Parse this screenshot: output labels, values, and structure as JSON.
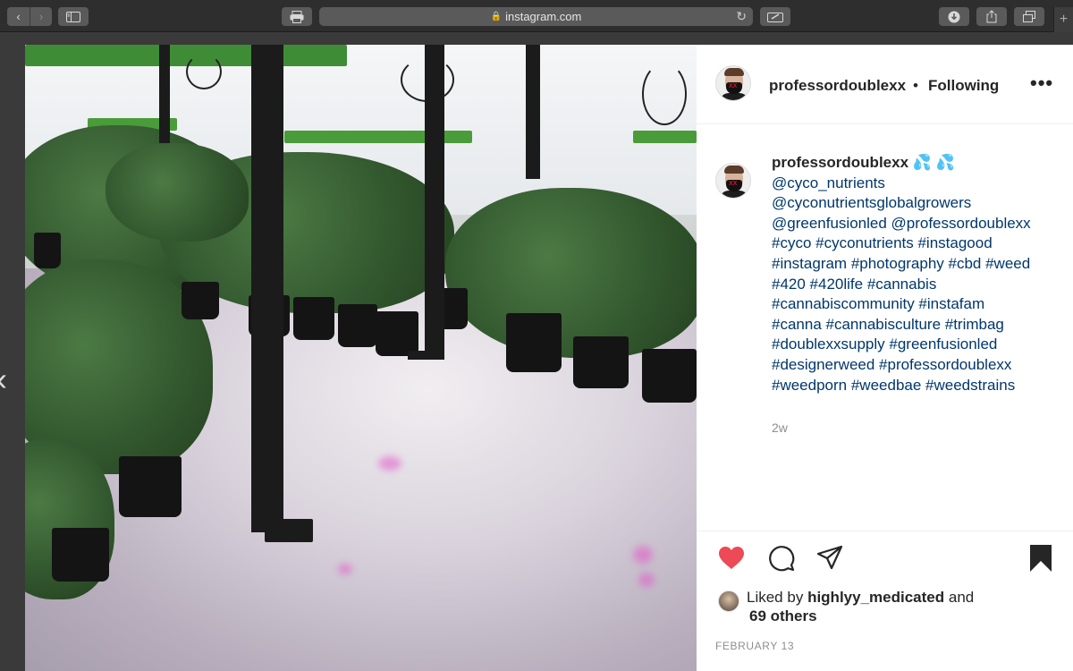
{
  "browser": {
    "url": "instagram.com"
  },
  "post": {
    "header": {
      "username": "professordoublexx",
      "separator": "•",
      "follow_status": "Following",
      "more": "•••"
    },
    "caption": {
      "username": "professordoublexx",
      "emoji": "💦 💦",
      "lines": [
        "@cyco_nutrients",
        "@cyconutrientsglobalgrowers",
        "@greenfusionled @professordoublexx",
        "#cyco #cyconutrients #instagood",
        "#instagram #photography #cbd #weed",
        "#420 #420life #cannabis",
        "#cannabiscommunity #instafam",
        "#canna #cannabisculture #trimbag",
        "#doublexxsupply #greenfusionled",
        "#designerweed #professordoublexx",
        "#weedporn #weedbae #weedstrains"
      ],
      "time_ago": "2w"
    },
    "likes": {
      "prefix": "Liked by",
      "user": "highlyy_medicated",
      "conjunction": "and",
      "others": "69 others"
    },
    "date": "FEBRUARY 13"
  },
  "icons": [
    "back-icon",
    "forward-icon",
    "sidebar-icon",
    "print-icon",
    "lock-icon",
    "reload-icon",
    "markup-icon",
    "download-icon",
    "share-icon",
    "tabs-icon",
    "new-tab-icon",
    "previous-post-icon",
    "heart-icon",
    "comment-icon",
    "share-direct-icon",
    "bookmark-icon"
  ],
  "colors": {
    "liked_heart": "#ed4956",
    "link": "#00376b",
    "text": "#262626",
    "muted": "#8e8e8e"
  }
}
